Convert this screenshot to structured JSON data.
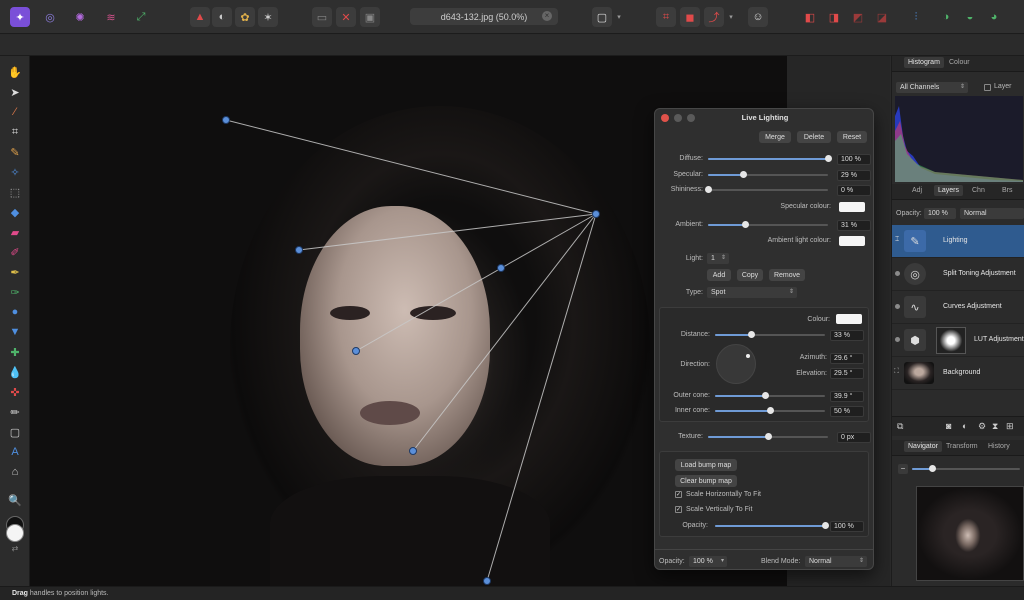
{
  "toolbar": {
    "document_title": "d643-132.jpg (50.0%)",
    "close_symbol": "×"
  },
  "status_bar": {
    "bold_text": "Drag",
    "text": " handles to position lights."
  },
  "dialog": {
    "title": "Live Lighting",
    "merge": "Merge",
    "delete": "Delete",
    "reset": "Reset",
    "diffuse_label": "Diffuse:",
    "diffuse_value": "100 %",
    "diffuse_fraction": 1.0,
    "specular_label": "Specular:",
    "specular_value": "29 %",
    "specular_fraction": 0.29,
    "shininess_label": "Shininess:",
    "shininess_value": "0 %",
    "shininess_fraction": 0.0,
    "specular_colour_label": "Specular colour:",
    "ambient_label": "Ambient:",
    "ambient_value": "31 %",
    "ambient_fraction": 0.31,
    "ambient_colour_label": "Ambient light colour:",
    "light_label": "Light:",
    "light_value": "1",
    "add": "Add",
    "copy": "Copy",
    "remove": "Remove",
    "type_label": "Type:",
    "type_value": "Spot",
    "colour_label": "Colour:",
    "distance_label": "Distance:",
    "distance_value": "33 %",
    "distance_fraction": 0.33,
    "direction_label": "Direction:",
    "azimuth_label": "Azimuth:",
    "azimuth_value": "29.6 °",
    "elevation_label": "Elevation:",
    "elevation_value": "29.5 °",
    "outer_cone_label": "Outer cone:",
    "outer_cone_value": "39.9 °",
    "outer_cone_fraction": 0.45,
    "inner_cone_label": "Inner cone:",
    "inner_cone_value": "50 %",
    "inner_cone_fraction": 0.5,
    "texture_label": "Texture:",
    "texture_value": "0 px",
    "texture_fraction": 0.5,
    "load_bump": "Load bump map",
    "clear_bump": "Clear bump map",
    "scale_h": "Scale Horizontally To Fit",
    "scale_v": "Scale Vertically To Fit",
    "check_mark": "✓",
    "opacity_label": "Opacity:",
    "opacity_value": "100 %",
    "opacity_fraction": 1.0,
    "footer_opacity_label": "Opacity:",
    "footer_opacity_value": "100 %",
    "blend_label": "Blend Mode:",
    "blend_value": "Normal"
  },
  "panels": {
    "histogram_tab": "Histogram",
    "colour_tab": "Colour",
    "channels": "All Channels",
    "layer_label": "Layer",
    "adj_tab": "Adj",
    "layers_tab": "Layers",
    "chn_tab": "Chn",
    "brs_tab": "Brs",
    "opacity_label": "Opacity:",
    "opacity_value": "100 %",
    "blend_value": "Normal",
    "layers": [
      {
        "name": "Lighting"
      },
      {
        "name": "Split Toning Adjustment"
      },
      {
        "name": "Curves Adjustment"
      },
      {
        "name": "LUT Adjustment"
      },
      {
        "name": "Background"
      }
    ],
    "navigator_tab": "Navigator",
    "transform_tab": "Transform",
    "history_tab": "History"
  },
  "colors": {
    "accent": "#6f9bd6",
    "selected_layer": "#2f5b8f",
    "light_handle": "#5b8fd9"
  }
}
